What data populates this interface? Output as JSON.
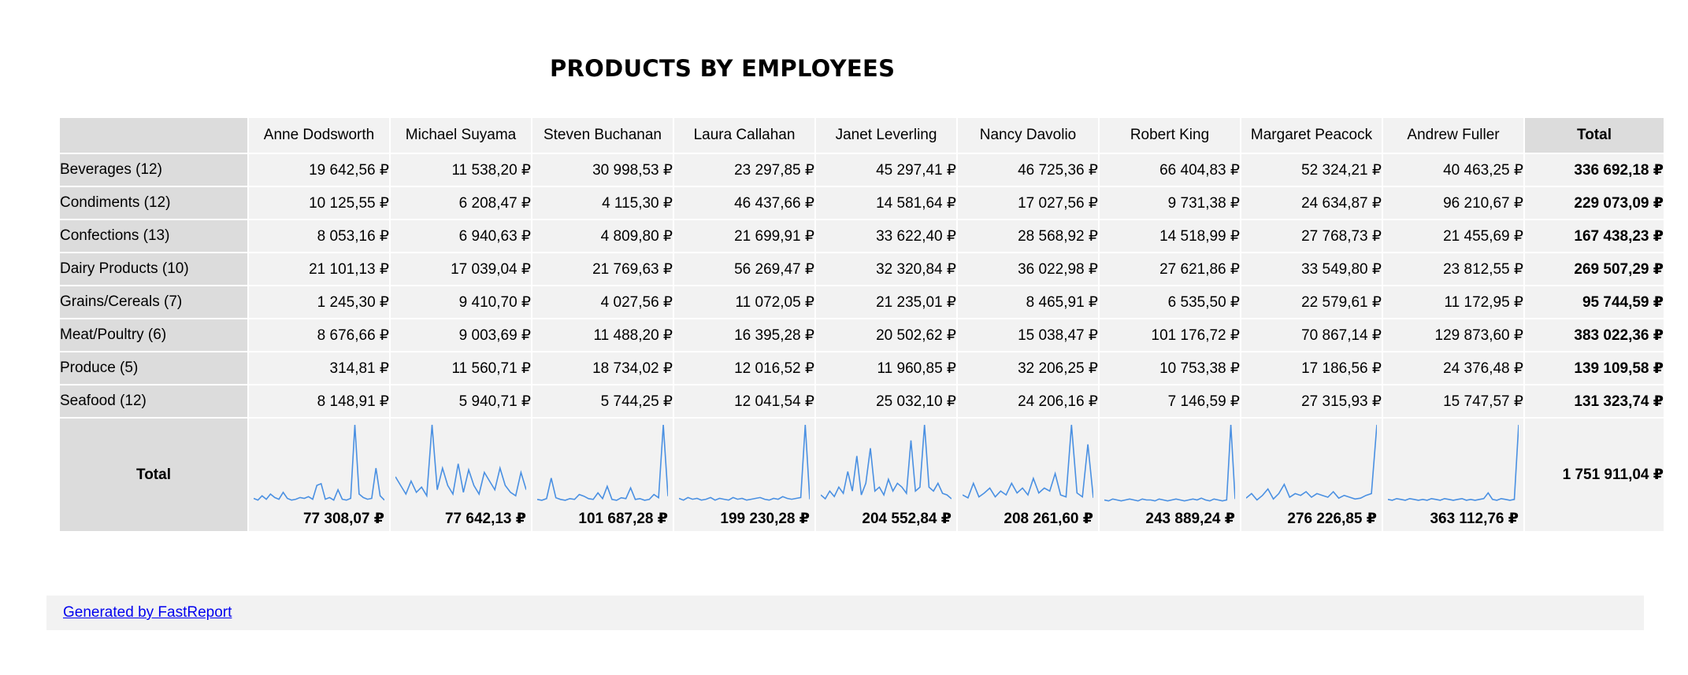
{
  "title": "PRODUCTS BY EMPLOYEES",
  "columns": [
    "Anne Dodsworth",
    "Michael Suyama",
    "Steven Buchanan",
    "Laura Callahan",
    "Janet Leverling",
    "Nancy Davolio",
    "Robert King",
    "Margaret Peacock",
    "Andrew Fuller"
  ],
  "total_label": "Total",
  "rows": [
    {
      "label": "Beverages (12)",
      "values": [
        "19 642,56 ₽",
        "11 538,20 ₽",
        "30 998,53 ₽",
        "23 297,85 ₽",
        "45 297,41 ₽",
        "46 725,36 ₽",
        "66 404,83 ₽",
        "52 324,21 ₽",
        "40 463,25 ₽"
      ],
      "total": "336 692,18 ₽"
    },
    {
      "label": "Condiments (12)",
      "values": [
        "10 125,55 ₽",
        "6 208,47 ₽",
        "4 115,30 ₽",
        "46 437,66 ₽",
        "14 581,64 ₽",
        "17 027,56 ₽",
        "9 731,38 ₽",
        "24 634,87 ₽",
        "96 210,67 ₽"
      ],
      "total": "229 073,09 ₽"
    },
    {
      "label": "Confections (13)",
      "values": [
        "8 053,16 ₽",
        "6 940,63 ₽",
        "4 809,80 ₽",
        "21 699,91 ₽",
        "33 622,40 ₽",
        "28 568,92 ₽",
        "14 518,99 ₽",
        "27 768,73 ₽",
        "21 455,69 ₽"
      ],
      "total": "167 438,23 ₽"
    },
    {
      "label": "Dairy Products (10)",
      "values": [
        "21 101,13 ₽",
        "17 039,04 ₽",
        "21 769,63 ₽",
        "56 269,47 ₽",
        "32 320,84 ₽",
        "36 022,98 ₽",
        "27 621,86 ₽",
        "33 549,80 ₽",
        "23 812,55 ₽"
      ],
      "total": "269 507,29 ₽"
    },
    {
      "label": "Grains/Cereals (7)",
      "values": [
        "1 245,30 ₽",
        "9 410,70 ₽",
        "4 027,56 ₽",
        "11 072,05 ₽",
        "21 235,01 ₽",
        "8 465,91 ₽",
        "6 535,50 ₽",
        "22 579,61 ₽",
        "11 172,95 ₽"
      ],
      "total": "95 744,59 ₽"
    },
    {
      "label": "Meat/Poultry (6)",
      "values": [
        "8 676,66 ₽",
        "9 003,69 ₽",
        "11 488,20 ₽",
        "16 395,28 ₽",
        "20 502,62 ₽",
        "15 038,47 ₽",
        "101 176,72 ₽",
        "70 867,14 ₽",
        "129 873,60 ₽"
      ],
      "total": "383 022,36 ₽"
    },
    {
      "label": "Produce (5)",
      "values": [
        "314,81 ₽",
        "11 560,71 ₽",
        "18 734,02 ₽",
        "12 016,52 ₽",
        "11 960,85 ₽",
        "32 206,25 ₽",
        "10 753,38 ₽",
        "17 186,56 ₽",
        "24 376,48 ₽"
      ],
      "total": "139 109,58 ₽"
    },
    {
      "label": "Seafood (12)",
      "values": [
        "8 148,91 ₽",
        "5 940,71 ₽",
        "5 744,25 ₽",
        "12 041,54 ₽",
        "25 032,10 ₽",
        "24 206,16 ₽",
        "7 146,59 ₽",
        "27 315,93 ₽",
        "15 747,57 ₽"
      ],
      "total": "131 323,74 ₽"
    }
  ],
  "totals_row": {
    "label": "Total",
    "values": [
      "77 308,07 ₽",
      "77 642,13 ₽",
      "101 687,28 ₽",
      "199 230,28 ₽",
      "204 552,84 ₽",
      "208 261,60 ₽",
      "243 889,24 ₽",
      "276 226,85 ₽",
      "363 112,76 ₽"
    ],
    "grand_total": "1 751 911,04 ₽"
  },
  "sparkline_color": "#4a90e2",
  "sparklines": [
    [
      5,
      3,
      8,
      4,
      10,
      6,
      4,
      12,
      5,
      3,
      4,
      6,
      5,
      7,
      4,
      20,
      22,
      4,
      6,
      3,
      15,
      4,
      3,
      5,
      90,
      10,
      6,
      4,
      5,
      40,
      8,
      3
    ],
    [
      30,
      20,
      10,
      25,
      12,
      18,
      8,
      90,
      15,
      40,
      20,
      10,
      45,
      12,
      38,
      20,
      10,
      35,
      25,
      15,
      40,
      20,
      12,
      8,
      35,
      15
    ],
    [
      4,
      3,
      5,
      30,
      6,
      4,
      3,
      5,
      4,
      10,
      8,
      5,
      4,
      12,
      5,
      20,
      4,
      3,
      6,
      5,
      18,
      4,
      5,
      3,
      4,
      10,
      6,
      95,
      8
    ],
    [
      5,
      3,
      6,
      4,
      5,
      3,
      4,
      6,
      3,
      5,
      4,
      3,
      6,
      4,
      5,
      3,
      4,
      5,
      6,
      4,
      3,
      5,
      4,
      7,
      5,
      4,
      5,
      6,
      90,
      4
    ],
    [
      10,
      5,
      15,
      8,
      20,
      12,
      40,
      15,
      60,
      10,
      25,
      70,
      15,
      20,
      10,
      30,
      15,
      25,
      20,
      12,
      80,
      15,
      20,
      100,
      20,
      15,
      25,
      12,
      10,
      5
    ],
    [
      8,
      5,
      20,
      6,
      10,
      15,
      6,
      12,
      8,
      20,
      10,
      15,
      8,
      25,
      10,
      15,
      12,
      30,
      8,
      6,
      80,
      10,
      6,
      60,
      5
    ],
    [
      3,
      2,
      4,
      3,
      2,
      3,
      4,
      3,
      2,
      4,
      3,
      3,
      2,
      4,
      3,
      2,
      3,
      4,
      3,
      2,
      3,
      4,
      3,
      5,
      3,
      2,
      4,
      3,
      2,
      3,
      85,
      4
    ],
    [
      5,
      10,
      3,
      8,
      15,
      4,
      10,
      20,
      6,
      10,
      8,
      12,
      6,
      10,
      8,
      6,
      12,
      5,
      8,
      6,
      4,
      5,
      8,
      10,
      85
    ],
    [
      4,
      3,
      5,
      4,
      3,
      5,
      4,
      3,
      4,
      3,
      5,
      4,
      3,
      5,
      4,
      3,
      4,
      5,
      3,
      4,
      3,
      4,
      5,
      12,
      4,
      3,
      5,
      4,
      3,
      4,
      95
    ]
  ],
  "footer": {
    "link_text": "Generated by FastReport"
  }
}
